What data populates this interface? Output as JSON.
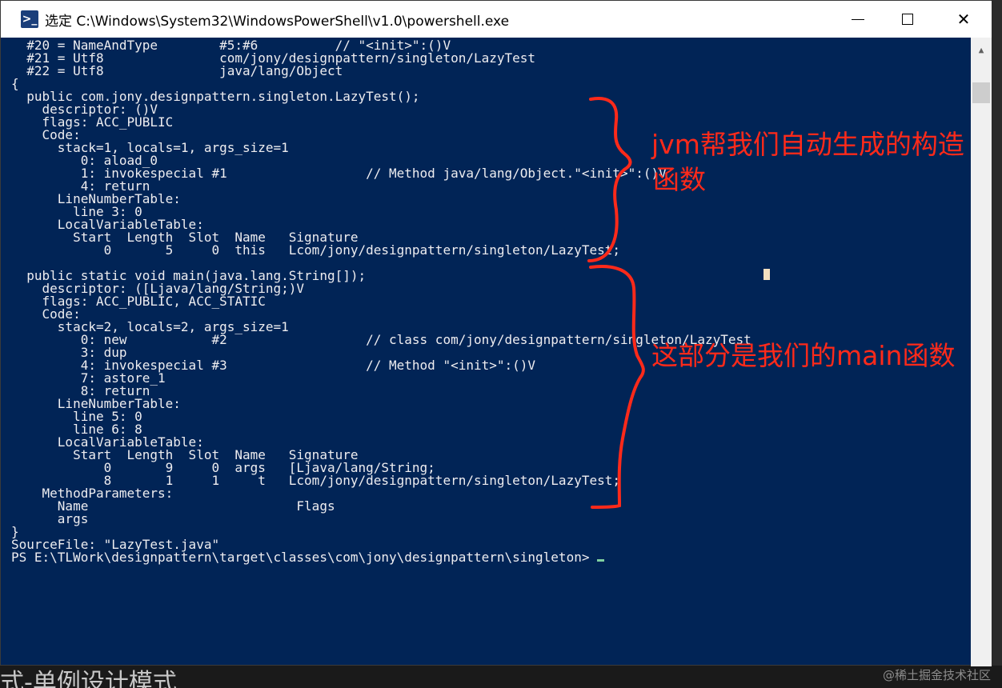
{
  "window": {
    "title": "选定 C:\\Windows\\System32\\WindowsPowerShell\\v1.0\\powershell.exe",
    "minimize_label": "minimize",
    "maximize_label": "maximize",
    "close_label": "✕"
  },
  "console": {
    "lines": [
      "  #20 = NameAndType        #5:#6          // \"<init>\":()V",
      "  #21 = Utf8               com/jony/designpattern/singleton/LazyTest",
      "  #22 = Utf8               java/lang/Object",
      "{",
      "  public com.jony.designpattern.singleton.LazyTest();",
      "    descriptor: ()V",
      "    flags: ACC_PUBLIC",
      "    Code:",
      "      stack=1, locals=1, args_size=1",
      "         0: aload_0",
      "         1: invokespecial #1                  // Method java/lang/Object.\"<init>\":()V",
      "         4: return",
      "      LineNumberTable:",
      "        line 3: 0",
      "      LocalVariableTable:",
      "        Start  Length  Slot  Name   Signature",
      "            0       5     0  this   Lcom/jony/designpattern/singleton/LazyTest;",
      "",
      "  public static void main(java.lang.String[]);",
      "    descriptor: ([Ljava/lang/String;)V",
      "    flags: ACC_PUBLIC, ACC_STATIC",
      "    Code:",
      "      stack=2, locals=2, args_size=1",
      "         0: new           #2                  // class com/jony/designpattern/singleton/LazyTest",
      "         3: dup",
      "         4: invokespecial #3                  // Method \"<init>\":()V",
      "         7: astore_1",
      "         8: return",
      "      LineNumberTable:",
      "        line 5: 0",
      "        line 6: 8",
      "      LocalVariableTable:",
      "        Start  Length  Slot  Name   Signature",
      "            0       9     0  args   [Ljava/lang/String;",
      "            8       1     1     t   Lcom/jony/designpattern/singleton/LazyTest;",
      "    MethodParameters:",
      "      Name                           Flags",
      "      args",
      "}",
      "SourceFile: \"LazyTest.java\""
    ],
    "prompt": "PS E:\\TLWork\\designpattern\\target\\classes\\com\\jony\\designpattern\\singleton> "
  },
  "annotations": {
    "constructor_line1": "jvm帮我们自动生成的构造",
    "constructor_line2": "函数",
    "main_note": "这部分是我们的main函数",
    "color": "#ff2a1a"
  },
  "background": {
    "partial_text": "式-单例设计模式",
    "watermark": "@稀土掘金技术社区"
  }
}
